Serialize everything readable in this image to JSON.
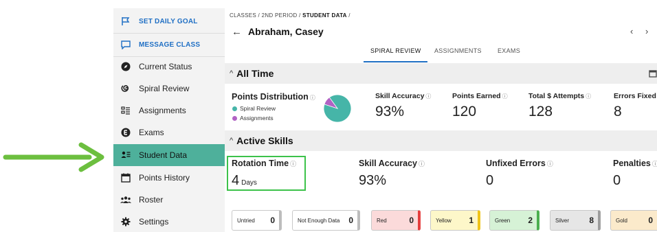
{
  "sidebar": {
    "items": [
      {
        "label": "SET DAILY GOAL",
        "icon": "flag-icon"
      },
      {
        "label": "MESSAGE CLASS",
        "icon": "message-icon"
      },
      {
        "label": "Current Status",
        "icon": "compass-icon"
      },
      {
        "label": "Spiral Review",
        "icon": "spiral-icon"
      },
      {
        "label": "Assignments",
        "icon": "assignments-icon"
      },
      {
        "label": "Exams",
        "icon": "exams-icon"
      },
      {
        "label": "Student Data",
        "icon": "student-data-icon"
      },
      {
        "label": "Points History",
        "icon": "calendar-icon"
      },
      {
        "label": "Roster",
        "icon": "roster-icon"
      },
      {
        "label": "Settings",
        "icon": "gear-icon"
      }
    ]
  },
  "breadcrumb": {
    "classes": "CLASSES",
    "sep1": "/",
    "period": "2ND PERIOD",
    "sep2": "/",
    "current": "STUDENT DATA",
    "sep3": "/"
  },
  "header": {
    "back": "←",
    "student_name": "Abraham, Casey",
    "prev": "‹",
    "next": "›"
  },
  "tabs": [
    "SPIRAL REVIEW",
    "ASSIGNMENTS",
    "EXAMS"
  ],
  "all_time": {
    "title": "All Time",
    "chevron": "^",
    "points_distribution": {
      "label": "Points Distribution",
      "legend": [
        {
          "label": "Spiral Review",
          "color": "#46b5a8"
        },
        {
          "label": "Assignments",
          "color": "#b162c4"
        }
      ],
      "spiral_share": 0.9
    },
    "stats": [
      {
        "label": "Skill Accuracy",
        "value": "93%"
      },
      {
        "label": "Points Earned",
        "value": "120"
      },
      {
        "label": "Total $ Attempts",
        "value": "128"
      },
      {
        "label": "Errors Fixed",
        "value": "8"
      }
    ]
  },
  "active_skills": {
    "title": "Active Skills",
    "chevron": "^",
    "rotation_time": {
      "label": "Rotation Time",
      "value": "4",
      "unit": "Days"
    },
    "stats": [
      {
        "label": "Skill Accuracy",
        "value": "93%"
      },
      {
        "label": "Unfixed Errors",
        "value": "0"
      },
      {
        "label": "Penalties",
        "value": "0"
      }
    ],
    "chips": [
      {
        "label": "Untried",
        "count": "0",
        "bg": "#ffffff",
        "accent": "#bdbdbd"
      },
      {
        "label": "Not Enough Data",
        "count": "0",
        "bg": "#ffffff",
        "accent": "#bdbdbd"
      },
      {
        "label": "Red",
        "count": "0",
        "bg": "#fbdada",
        "accent": "#e53e3e"
      },
      {
        "label": "Yellow",
        "count": "1",
        "bg": "#fdf7c9",
        "accent": "#f0c419"
      },
      {
        "label": "Green",
        "count": "2",
        "bg": "#d6f2d6",
        "accent": "#4caf50"
      },
      {
        "label": "Silver",
        "count": "8",
        "bg": "#e6e6e6",
        "accent": "#9e9e9e"
      },
      {
        "label": "Gold",
        "count": "0",
        "bg": "#fbeacb",
        "accent": "#e0a800"
      }
    ]
  },
  "colors": {
    "accent": "#1f6fc4",
    "active_nav": "#4eb09b",
    "annotation": "#6cbf3f",
    "highlight_box": "#3cc24a"
  }
}
